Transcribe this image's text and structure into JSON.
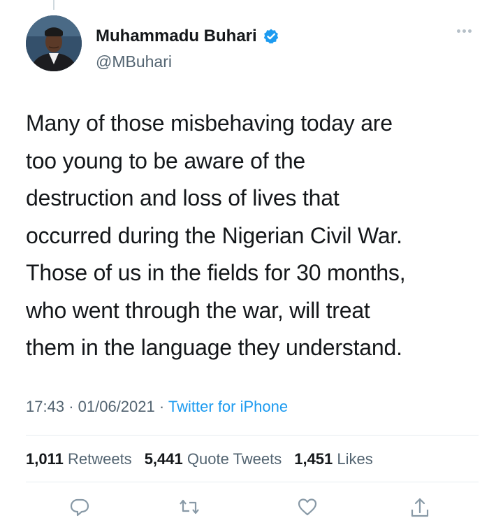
{
  "author": {
    "display_name": "Muhammadu Buhari",
    "handle": "@MBuhari",
    "verified": true
  },
  "tweet": {
    "text_lines": [
      "Many of those misbehaving today are",
      "too young to be aware of the",
      "destruction and loss of lives that",
      "occurred during the Nigerian Civil War.",
      "Those of us in the fields for 30 months,",
      "who went through the war, will treat",
      "them in the language they understand."
    ],
    "time": "17:43",
    "date": "01/06/2021",
    "separator": "·",
    "source": "Twitter for iPhone"
  },
  "stats": {
    "retweets": {
      "count": "1,011",
      "label": "Retweets"
    },
    "quote_tweets": {
      "count": "5,441",
      "label": "Quote Tweets"
    },
    "likes": {
      "count": "1,451",
      "label": "Likes"
    }
  },
  "icons": {
    "more": "more-dots-icon",
    "verified": "verified-badge-icon",
    "reply": "reply-icon",
    "retweet": "retweet-icon",
    "like": "heart-icon",
    "share": "share-icon"
  },
  "colors": {
    "text": "#14171a",
    "secondary": "#536471",
    "link": "#1d9bf0",
    "verified": "#1d9bf0",
    "divider": "#e6ecf0"
  }
}
